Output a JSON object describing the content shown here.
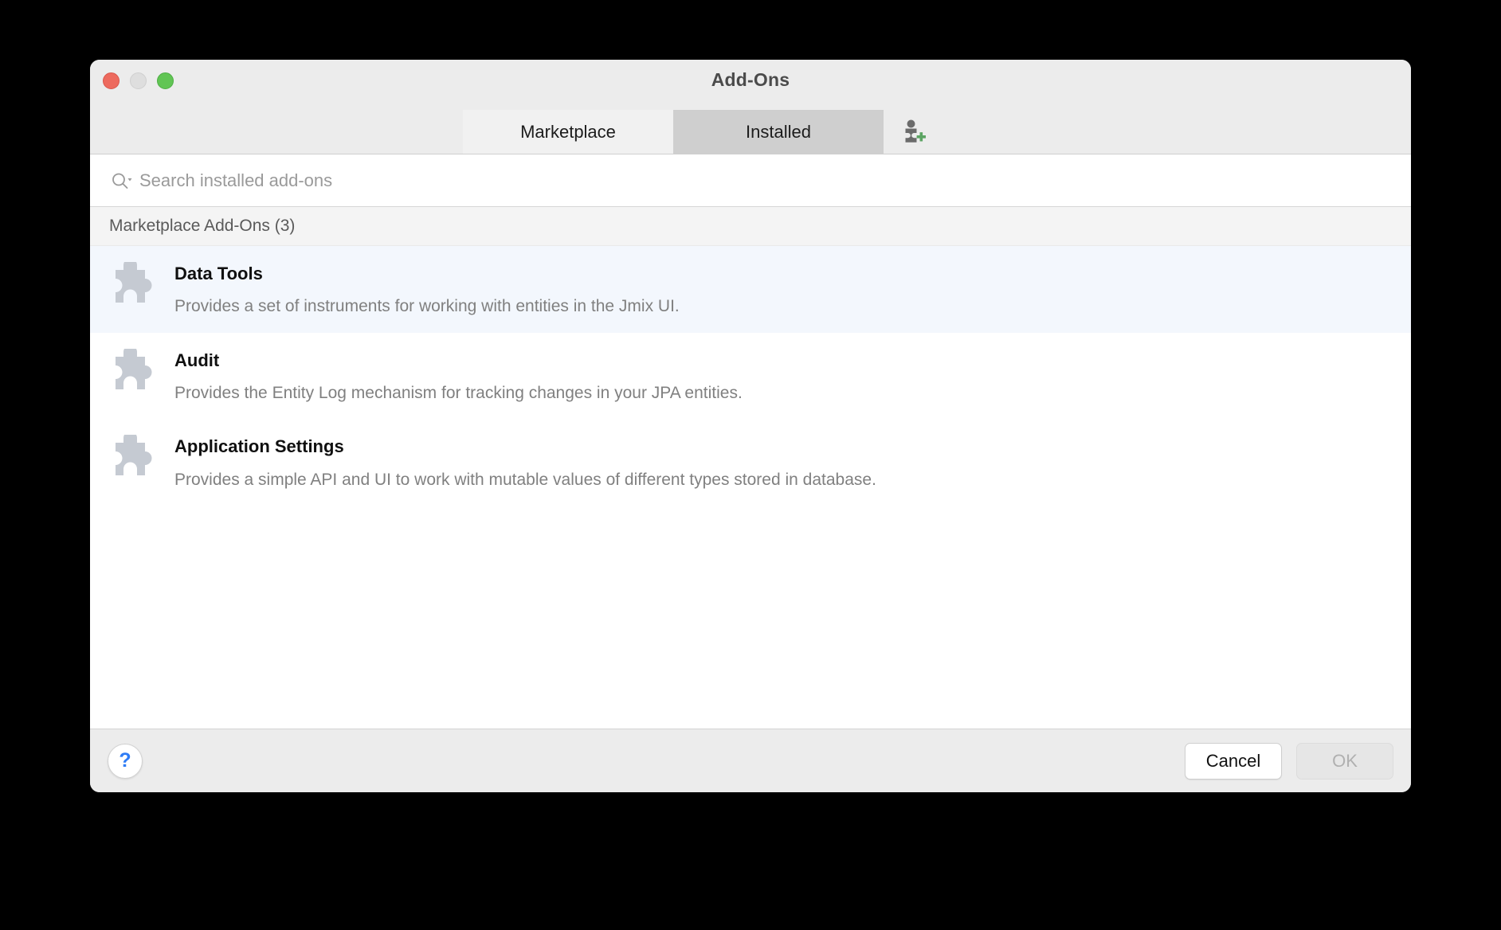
{
  "window": {
    "title": "Add-Ons",
    "traffic_lights": [
      {
        "name": "close",
        "color": "#ED6A5E"
      },
      {
        "name": "minimize",
        "color": "#DEDEDE"
      },
      {
        "name": "maximize",
        "color": "#61C554"
      }
    ]
  },
  "tabs": [
    {
      "label": "Marketplace",
      "active": false
    },
    {
      "label": "Installed",
      "active": true
    }
  ],
  "toolbar": {
    "install_from_disk_icon": "plugin-add-icon",
    "install_from_disk_icon_accent": "#5CA463"
  },
  "search": {
    "icon": "search-icon",
    "placeholder": "Search installed add-ons",
    "value": ""
  },
  "list": {
    "section_header": "Marketplace Add-Ons (3)",
    "items": [
      {
        "name": "Data Tools",
        "description": "Provides a set of instruments for working with entities in the Jmix UI.",
        "icon": "puzzle-icon",
        "selected": true
      },
      {
        "name": "Audit",
        "description": "Provides the Entity Log mechanism for tracking changes in your JPA entities.",
        "icon": "puzzle-icon",
        "selected": false
      },
      {
        "name": "Application Settings",
        "description": "Provides a simple API and UI to work with mutable values of different types stored in database.",
        "icon": "puzzle-icon",
        "selected": false
      }
    ]
  },
  "footer": {
    "help_label": "?",
    "cancel_label": "Cancel",
    "ok_label": "OK",
    "ok_disabled": true
  },
  "colors": {
    "selected_row": "#F3F7FD",
    "active_tab": "#CFCFCF",
    "inactive_tab": "#F1F1F1",
    "help_blue": "#2E7CF6",
    "puzzle_gray": "#C5CAD2"
  }
}
